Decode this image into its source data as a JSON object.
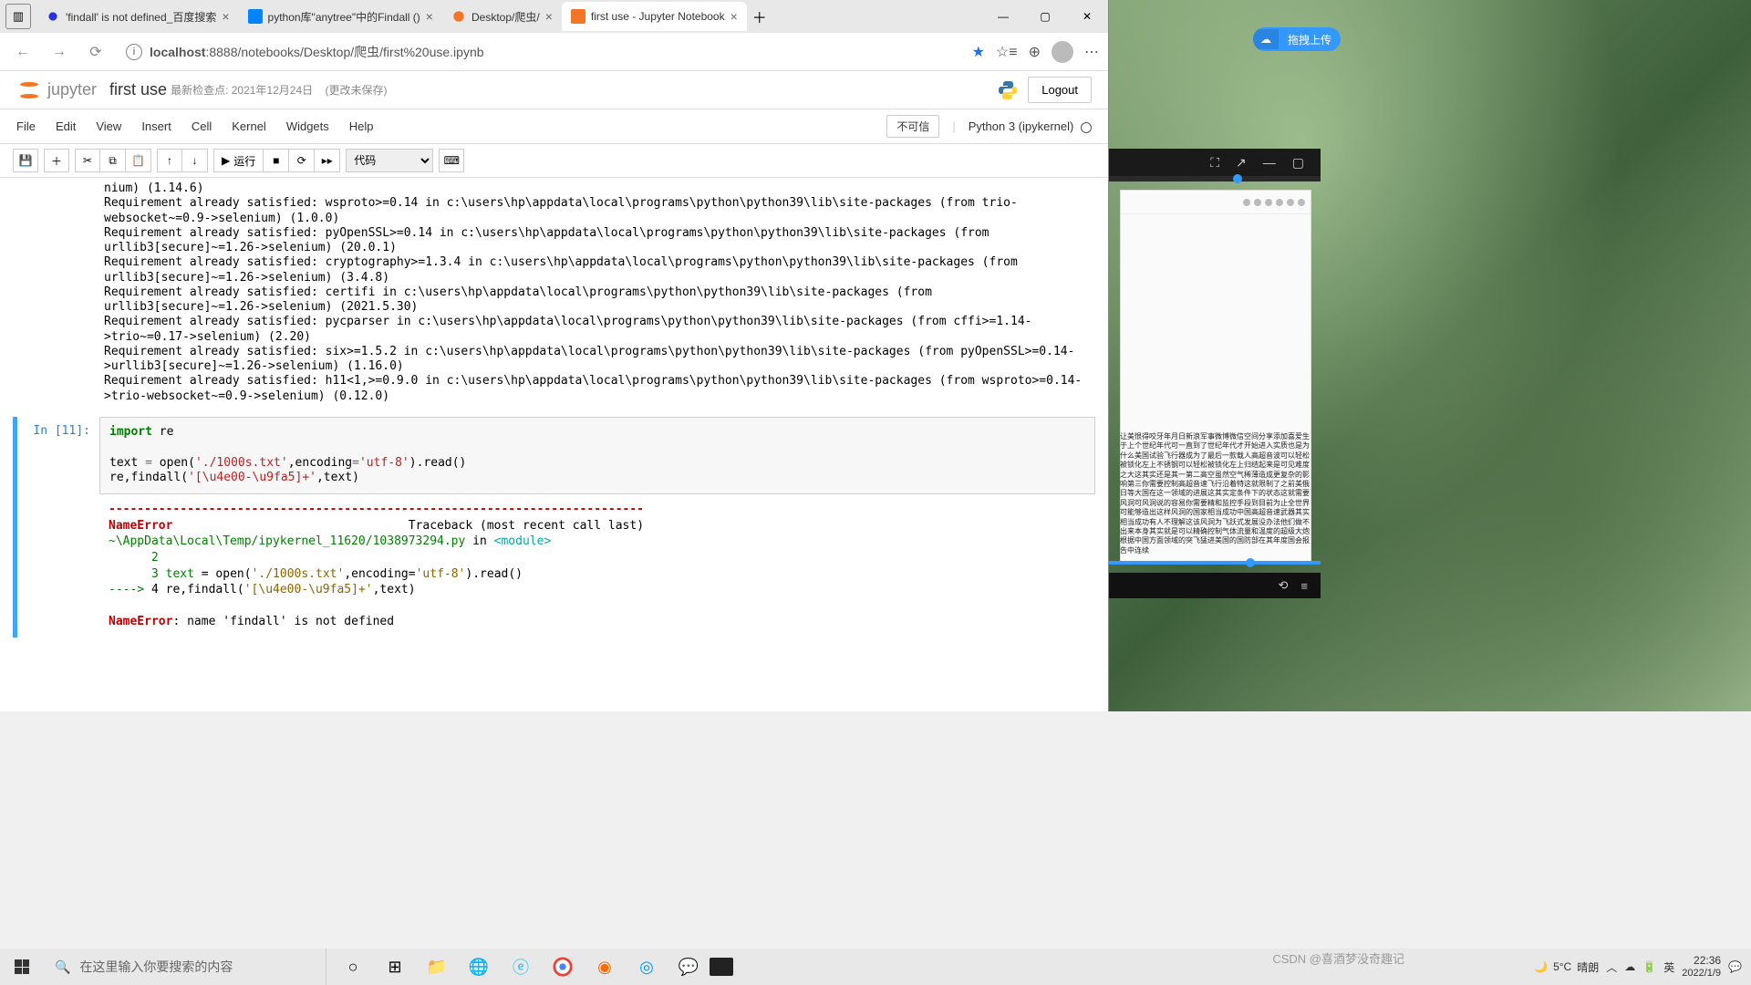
{
  "browser": {
    "tabs": [
      {
        "label": "'findall' is not defined_百度搜索",
        "favicon": "baidu"
      },
      {
        "label": "python库\"anytree\"中的Findall ()",
        "favicon": "zhihu"
      },
      {
        "label": "Desktop/爬虫/",
        "favicon": "jupyter"
      },
      {
        "label": "first use - Jupyter Notebook",
        "favicon": "jupyter-nb",
        "active": true
      }
    ],
    "url_host": "localhost",
    "url_path": ":8888/notebooks/Desktop/爬虫/first%20use.ipynb"
  },
  "jupyter": {
    "logo_text": "jupyter",
    "notebook_name": "first use",
    "checkpoint": "最新检查点: 2021年12月24日",
    "unsaved": "(更改未保存)",
    "logout": "Logout",
    "menus": [
      "File",
      "Edit",
      "View",
      "Insert",
      "Cell",
      "Kernel",
      "Widgets",
      "Help"
    ],
    "trusted": "不可信",
    "kernel": "Python 3 (ipykernel)",
    "run_label": "运行",
    "celltype": "代码"
  },
  "output_head": "Requirement already satisfied: wsproto>=0.14 in c:\\users\\hp\\appdata\\local\\programs\\python\\python39\\lib\\site-packages (from trio-websocket~=0.9->selenium) (1.0.0)\nRequirement already satisfied: pyOpenSSL>=0.14 in c:\\users\\hp\\appdata\\local\\programs\\python\\python39\\lib\\site-packages (from urllib3[secure]~=1.26->selenium) (20.0.1)\nRequirement already satisfied: cryptography>=1.3.4 in c:\\users\\hp\\appdata\\local\\programs\\python\\python39\\lib\\site-packages (from urllib3[secure]~=1.26->selenium) (3.4.8)\nRequirement already satisfied: certifi in c:\\users\\hp\\appdata\\local\\programs\\python\\python39\\lib\\site-packages (from urllib3[secure]~=1.26->selenium) (2021.5.30)\nRequirement already satisfied: pycparser in c:\\users\\hp\\appdata\\local\\programs\\python\\python39\\lib\\site-packages (from cffi>=1.14->trio~=0.17->selenium) (2.20)\nRequirement already satisfied: six>=1.5.2 in c:\\users\\hp\\appdata\\local\\programs\\python\\python39\\lib\\site-packages (from pyOpenSSL>=0.14->urllib3[secure]~=1.26->selenium) (1.16.0)\nRequirement already satisfied: h11<1,>=0.9.0 in c:\\users\\hp\\appdata\\local\\programs\\python\\python39\\lib\\site-packages (from wsproto>=0.14->trio-websocket~=0.9->selenium) (0.12.0)",
  "output_pre_line": "nium) (1.14.6)",
  "cell": {
    "prompt": "In  [11]:",
    "code_line1_kw": "import",
    "code_line1_rest": " re",
    "code_line2a": "text ",
    "code_line2b": "=",
    "code_line2c": " open(",
    "code_line2d": "'./1000s.txt'",
    "code_line2e": ",encoding",
    "code_line2f": "=",
    "code_line2g": "'utf-8'",
    "code_line2h": ").read()",
    "code_line3a": "re,findall(",
    "code_line3b": "'[\\u4e00-\\u9fa5]+'",
    "code_line3c": ",text)"
  },
  "error": {
    "sep": "---------------------------------------------------------------------------",
    "name": "NameError",
    "traceback": "Traceback (most recent call last)",
    "file": "~\\AppData\\Local\\Temp/ipykernel_11620/1038973294.py",
    "in": " in ",
    "module": "<module>",
    "l2": "      2 ",
    "l3a": "      3 text ",
    "l3b": "=",
    "l3c": " open(",
    "l3d": "'./1000s.txt'",
    "l3e": ",encoding",
    "l3f": "=",
    "l3g": "'utf-8'",
    "l3h": ").read()",
    "arrow": "----> ",
    "l4a": "4 re,findall(",
    "l4b": "'[\\u4e00-\\u9fa5]+'",
    "l4c": ",text)",
    "final_name": "NameError",
    "final_msg": ": name 'findall' is not defined"
  },
  "upload_label": "拖拽上传",
  "mini_text": "让美恨得咬牙年月日新浪军事微博微信空间分享添加喜爱生于上个世纪年代可一直到了世纪年代才开始进入实质也是为什么美国试验飞行器成为了最后一款载人高超音波可以轻松被锁化左上不锈钢可以轻松被锁化左上归结起来是可见难度之大这其实还是其一第二高空虽然空气稀薄造成更复杂的影响第三你需要控制高超音速飞行沿着特这就限制了之前美俄日等大国在这一领域的进展这其实定条件下的状态这就需要风洞可风洞说的容易你需要精和监控手段到目前为止全世界可能够造出这样风洞的国家相当成功中国高超音速武器其实相当成功有人不理解这该风洞为飞跃式发展没办法他们做不出来本身其实就是可以精确控制气体流量和温度的超级大炮根据中国方面领域的突飞猛进美国的国防部在其年度国会报告中连续",
  "taskbar": {
    "search_placeholder": "在这里输入你要搜索的内容",
    "weather_temp": "5°C",
    "weather_text": "晴朗",
    "ime": "英",
    "time": "22:36",
    "date": "2022/1/9",
    "watermark": "CSDN @喜酒梦没奇趣记"
  }
}
